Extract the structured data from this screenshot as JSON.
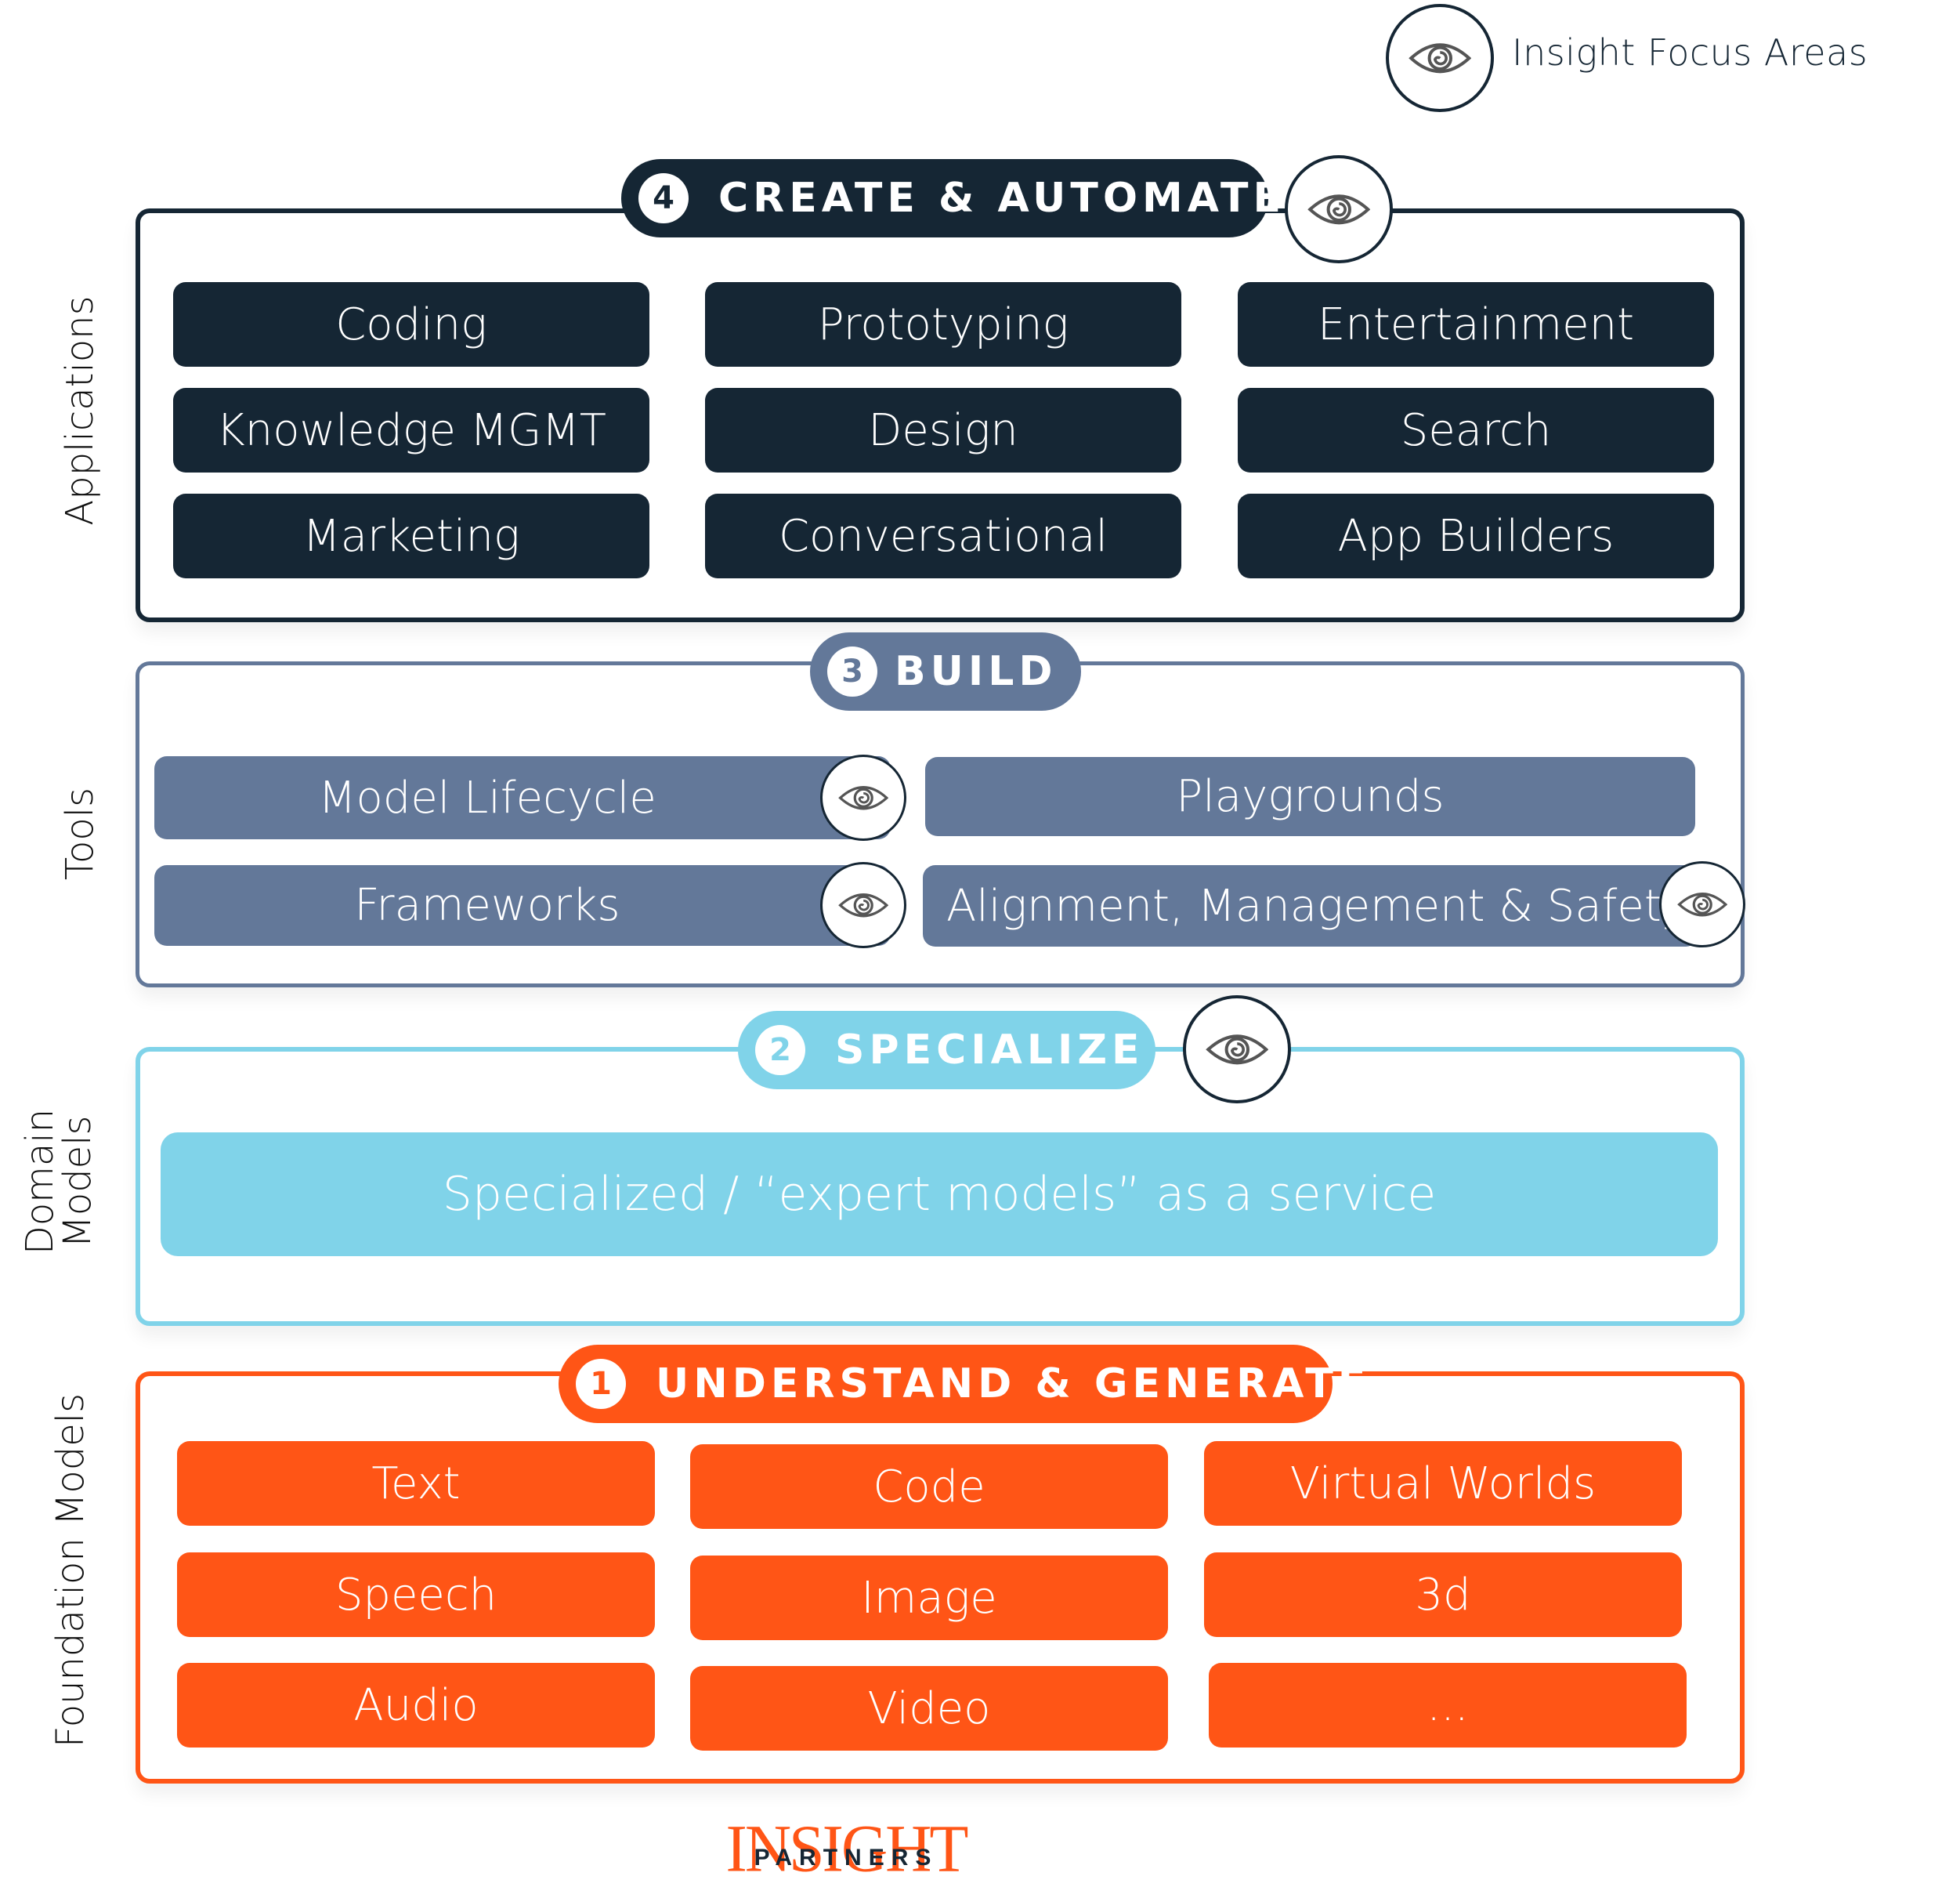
{
  "legend": {
    "icon": "eye-icon",
    "label": "Insight Focus Areas"
  },
  "colors": {
    "applications": "#152634",
    "tools": "#637899",
    "domain_models": "#80d3e9",
    "foundation_models": "#ff5516",
    "eye_stroke": "#555555"
  },
  "layers": {
    "applications": {
      "side_label": "Applications",
      "step_number": "4",
      "title": "CREATE & AUTOMATE",
      "focus_area": true,
      "items": [
        "Coding",
        "Prototyping",
        "Entertainment",
        "Knowledge MGMT",
        "Design",
        "Search",
        "Marketing",
        "Conversational",
        "App Builders"
      ]
    },
    "tools": {
      "side_label": "Tools",
      "step_number": "3",
      "title": "BUILD",
      "items": [
        {
          "label": "Model Lifecycle",
          "focus_area": true
        },
        {
          "label": "Playgrounds",
          "focus_area": false
        },
        {
          "label": "Frameworks",
          "focus_area": true
        },
        {
          "label": "Alignment, Management & Safety",
          "focus_area": true
        }
      ]
    },
    "domain_models": {
      "side_label_line1": "Domain",
      "side_label_line2": "Models",
      "step_number": "2",
      "title": "SPECIALIZE",
      "focus_area": true,
      "items": [
        "Specialized / “expert models” as a service"
      ]
    },
    "foundation_models": {
      "side_label": "Foundation Models",
      "step_number": "1",
      "title": "UNDERSTAND & GENERATE",
      "items": [
        "Text",
        "Code",
        "Virtual Worlds",
        "Speech",
        "Image",
        "3d",
        "Audio",
        "Video",
        "..."
      ]
    }
  },
  "logo": {
    "main": "INSIGHT",
    "sub": "PARTNERS"
  }
}
